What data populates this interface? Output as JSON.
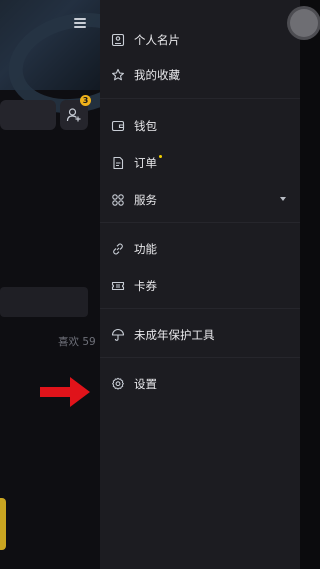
{
  "background": {
    "likes_text": "喜欢 59",
    "friend_badge_count": "3"
  },
  "drawer": {
    "items": [
      {
        "label": "个人名片",
        "icon": "id-card-icon"
      },
      {
        "label": "我的收藏",
        "icon": "star-icon"
      },
      {
        "label": "钱包",
        "icon": "wallet-icon"
      },
      {
        "label": "订单",
        "icon": "order-icon",
        "has_dot": true
      },
      {
        "label": "服务",
        "icon": "grid-icon",
        "expandable": true
      },
      {
        "label": "功能",
        "icon": "link-icon"
      },
      {
        "label": "卡券",
        "icon": "ticket-icon"
      },
      {
        "label": "未成年保护工具",
        "icon": "umbrella-icon"
      },
      {
        "label": "设置",
        "icon": "gear-icon"
      }
    ]
  },
  "colors": {
    "drawer_bg": "#1c1c21",
    "badge": "#f0b21a",
    "dot": "#f2d000",
    "arrow": "#e0131a"
  }
}
